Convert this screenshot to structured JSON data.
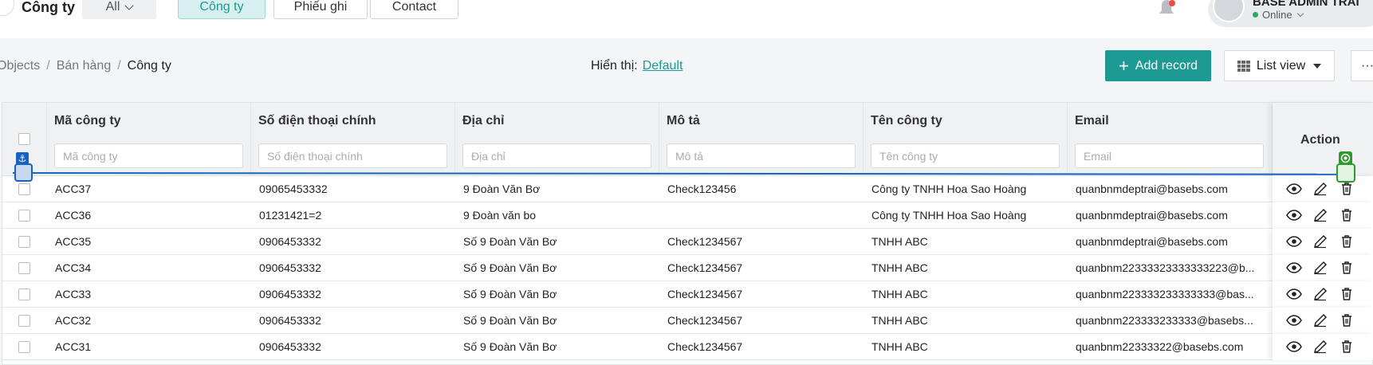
{
  "header": {
    "app_title": "Công ty",
    "filters": [
      {
        "label": "All"
      },
      {
        "label": "Công ty"
      },
      {
        "label": "Phiếu ghi"
      },
      {
        "label": "Contact"
      }
    ],
    "user": {
      "name": "BASE ADMIN TRAI",
      "status": "Online"
    }
  },
  "toolbar": {
    "breadcrumb": [
      "Objects",
      "Bán hàng",
      "Công ty"
    ],
    "view_label": "Hiển thị:",
    "view_value": "Default",
    "add_label": "Add record",
    "list_label": "List view",
    "more_label": "···"
  },
  "table": {
    "columns": [
      {
        "label": "Mã công ty",
        "placeholder": "Mã công ty"
      },
      {
        "label": "Số điện thoại chính",
        "placeholder": "Số điện thoại chính"
      },
      {
        "label": "Địa chỉ",
        "placeholder": "Địa chỉ"
      },
      {
        "label": "Mô tả",
        "placeholder": "Mô tả"
      },
      {
        "label": "Tên công ty",
        "placeholder": "Tên công ty"
      },
      {
        "label": "Email",
        "placeholder": "Email"
      }
    ],
    "action_label": "Action",
    "rows": [
      {
        "code": "ACC37",
        "phone": "09065453332",
        "address": "9 Đoàn Văn Bơ",
        "desc": "Check123456",
        "name": "Công ty TNHH Hoa Sao Hoàng",
        "email": "quanbnmdeptrai@basebs.com"
      },
      {
        "code": "ACC36",
        "phone": "01231421=2",
        "address": "9 Đoàn văn bo",
        "desc": "",
        "name": "Công ty TNHH Hoa Sao Hoàng",
        "email": "quanbnmdeptrai@basebs.com"
      },
      {
        "code": "ACC35",
        "phone": "0906453332",
        "address": "Số 9 Đoàn Văn Bơ",
        "desc": "Check1234567",
        "name": "TNHH ABC",
        "email": "quanbnmdeptrai@basebs.com"
      },
      {
        "code": "ACC34",
        "phone": "0906453332",
        "address": "Số 9 Đoàn Văn Bơ",
        "desc": "Check1234567",
        "name": "TNHH ABC",
        "email": "quanbnm22333323333333223@b..."
      },
      {
        "code": "ACC33",
        "phone": "0906453332",
        "address": "Số 9 Đoàn Văn Bơ",
        "desc": "Check1234567",
        "name": "TNHH ABC",
        "email": "quanbnm223333233333333@bas..."
      },
      {
        "code": "ACC32",
        "phone": "0906453332",
        "address": "Số 9 Đoàn Văn Bơ",
        "desc": "Check1234567",
        "name": "TNHH ABC",
        "email": "quanbnm223333233333@basebs..."
      },
      {
        "code": "ACC31",
        "phone": "0906453332",
        "address": "Số 9 Đoàn Văn Bơ",
        "desc": "Check1234567",
        "name": "TNHH ABC",
        "email": "quanbnm22333322@basebs.com"
      }
    ]
  },
  "colors": {
    "accent": "#1c9a93",
    "drag_line": "#1664c0",
    "drop_target": "#2e9a2e",
    "notification": "#e74c3c"
  },
  "icons": [
    "bell-icon",
    "avatar-icon",
    "plus-icon",
    "grid-icon",
    "caret-down-icon",
    "eye-icon",
    "pencil-icon",
    "trash-icon",
    "anchor-icon",
    "target-icon"
  ]
}
